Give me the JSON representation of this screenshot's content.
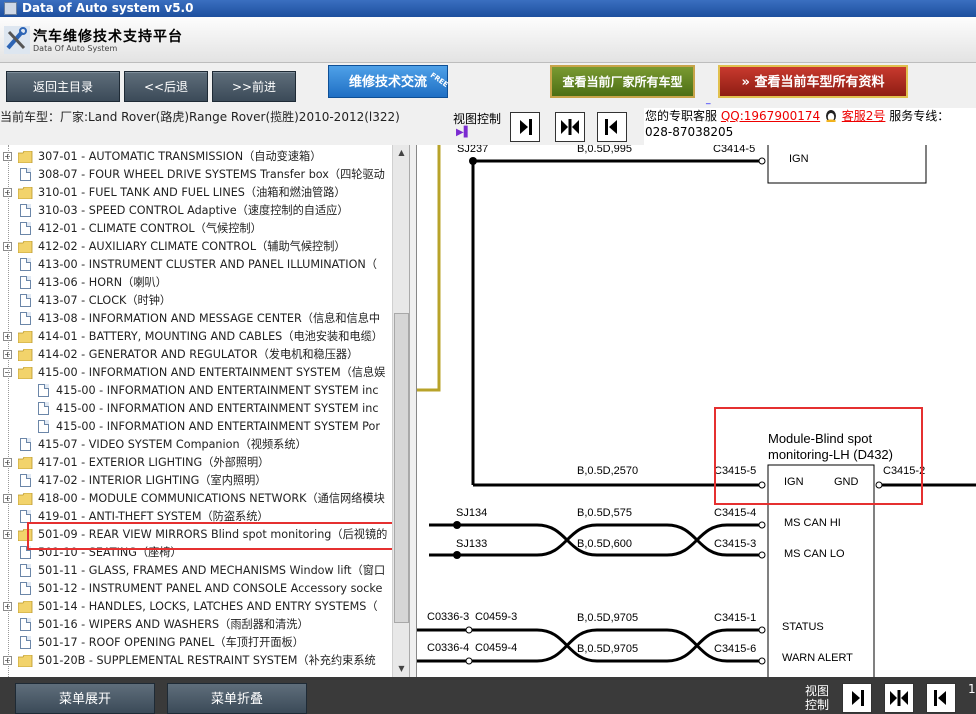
{
  "window": {
    "title": "Data of Auto system v5.0"
  },
  "header": {
    "title": "汽车维修技术支持平台",
    "subtitle": "Data Of Auto System"
  },
  "toolbar": {
    "home": "返回主目录",
    "back": "<<后退",
    "forward": ">>前进",
    "exchange": "维修技术交流",
    "exchange_badge": "FREE",
    "all_models": "查看当前厂家所有车型",
    "all_data": "查看当前车型所有资料",
    "underscore": "_"
  },
  "info": {
    "current_model": "当前车型：厂家:Land Rover(路虎)Range Rover(揽胜)2010-2012(l322)",
    "view_control": "视图控制",
    "service_prefix": "您的专职客服",
    "qq": "QQ:1967900174",
    "service_name": "客服2号",
    "hotline": "服务专线：028-87038205"
  },
  "tree": [
    {
      "code": "307-01 - AUTOMATIC TRANSMISSION（自动变速箱）",
      "type": "folder",
      "level": 0,
      "expand": true
    },
    {
      "code": "308-07 - FOUR WHEEL DRIVE SYSTEMS Transfer box（四轮驱动",
      "type": "doc",
      "level": 0,
      "expand": false
    },
    {
      "code": "310-01 - FUEL TANK AND FUEL LINES（油箱和燃油管路）",
      "type": "folder",
      "level": 0,
      "expand": true
    },
    {
      "code": "310-03 - SPEED CONTROL Adaptive（速度控制的自适应）",
      "type": "doc",
      "level": 0,
      "expand": false
    },
    {
      "code": "412-01 - CLIMATE CONTROL（气候控制）",
      "type": "doc",
      "level": 0,
      "expand": false
    },
    {
      "code": "412-02 - AUXILIARY CLIMATE CONTROL（辅助气候控制）",
      "type": "folder",
      "level": 0,
      "expand": true
    },
    {
      "code": "413-00 - INSTRUMENT CLUSTER AND PANEL ILLUMINATION（",
      "type": "doc",
      "level": 0,
      "expand": false
    },
    {
      "code": "413-06 - HORN（喇叭）",
      "type": "doc",
      "level": 0,
      "expand": false
    },
    {
      "code": "413-07 - CLOCK（时钟）",
      "type": "doc",
      "level": 0,
      "expand": false
    },
    {
      "code": "413-08 - INFORMATION AND MESSAGE CENTER（信息和信息中",
      "type": "doc",
      "level": 0,
      "expand": false
    },
    {
      "code": "414-01 - BATTERY, MOUNTING AND CABLES（电池安装和电缆）",
      "type": "folder",
      "level": 0,
      "expand": true
    },
    {
      "code": "414-02 - GENERATOR AND REGULATOR（发电机和稳压器）",
      "type": "folder",
      "level": 0,
      "expand": true
    },
    {
      "code": "415-00 - INFORMATION AND ENTERTAINMENT SYSTEM（信息娱",
      "type": "folder",
      "level": 0,
      "expand": true,
      "open": true
    },
    {
      "code": "415-00 - INFORMATION AND ENTERTAINMENT SYSTEM inc",
      "type": "doc",
      "level": 1,
      "expand": false
    },
    {
      "code": "415-00 - INFORMATION AND ENTERTAINMENT SYSTEM inc",
      "type": "doc",
      "level": 1,
      "expand": false
    },
    {
      "code": "415-00 - INFORMATION AND ENTERTAINMENT SYSTEM Por",
      "type": "doc",
      "level": 1,
      "expand": false
    },
    {
      "code": "415-07 - VIDEO SYSTEM Companion（视频系统）",
      "type": "doc",
      "level": 0,
      "expand": false
    },
    {
      "code": "417-01 - EXTERIOR LIGHTING（外部照明）",
      "type": "folder",
      "level": 0,
      "expand": true
    },
    {
      "code": "417-02 - INTERIOR LIGHTING（室内照明）",
      "type": "doc",
      "level": 0,
      "expand": false
    },
    {
      "code": "418-00 - MODULE COMMUNICATIONS NETWORK（通信网络模块",
      "type": "folder",
      "level": 0,
      "expand": true
    },
    {
      "code": "419-01 - ANTI-THEFT SYSTEM（防盗系统）",
      "type": "doc",
      "level": 0,
      "expand": false
    },
    {
      "code": "501-09 - REAR VIEW MIRRORS Blind spot monitoring（后视镜的",
      "type": "folder",
      "level": 0,
      "expand": true
    },
    {
      "code": "501-10 - SEATING（座椅）",
      "type": "doc",
      "level": 0,
      "expand": false
    },
    {
      "code": "501-11 - GLASS, FRAMES AND MECHANISMS Window lift（窗口",
      "type": "doc",
      "level": 0,
      "expand": false
    },
    {
      "code": "501-12 - INSTRUMENT PANEL AND CONSOLE Accessory socke",
      "type": "doc",
      "level": 0,
      "expand": false
    },
    {
      "code": "501-14 - HANDLES, LOCKS, LATCHES AND ENTRY SYSTEMS（",
      "type": "folder",
      "level": 0,
      "expand": true
    },
    {
      "code": "501-16 - WIPERS AND WASHERS（雨刮器和清洗）",
      "type": "doc",
      "level": 0,
      "expand": false
    },
    {
      "code": "501-17 - ROOF OPENING PANEL（车顶打开面板）",
      "type": "doc",
      "level": 0,
      "expand": false
    },
    {
      "code": "501-20B - SUPPLEMENTAL RESTRAINT SYSTEM（补充约束系统",
      "type": "folder",
      "level": 0,
      "expand": true
    }
  ],
  "diagram": {
    "sj237": "SJ237",
    "w1": "B,0.5D,995",
    "c1": "C3414-5",
    "ign_top": "IGN",
    "module_title_1": "Module-Blind spot",
    "module_title_2": "monitoring-LH (D432)",
    "w2": "B,0.5D,2570",
    "c2": "C3415-5",
    "c2b": "C3415-2",
    "ign": "IGN",
    "gnd": "GND",
    "sj134": "SJ134",
    "sj133": "SJ133",
    "w3": "B,0.5D,575",
    "w4": "B,0.5D,600",
    "c3": "C3415-4",
    "c4": "C3415-3",
    "ms_can_hi": "MS CAN HI",
    "ms_can_lo": "MS CAN LO",
    "c0336_3": "C0336-3",
    "c0459_3": "C0459-3",
    "c0336_4": "C0336-4",
    "c0459_4": "C0459-4",
    "w5": "B,0.5D,9705",
    "w6": "B,0.5D,9705",
    "c5": "C3415-1",
    "c6": "C3415-6",
    "status": "STATUS",
    "warn_alert": "WARN ALERT"
  },
  "bottom": {
    "expand": "菜单展开",
    "collapse": "菜单折叠",
    "view_control": "视图控制",
    "page": "1"
  },
  "colors": {
    "accent_red": "#e53030",
    "wire_olive": "#b8a32a"
  }
}
